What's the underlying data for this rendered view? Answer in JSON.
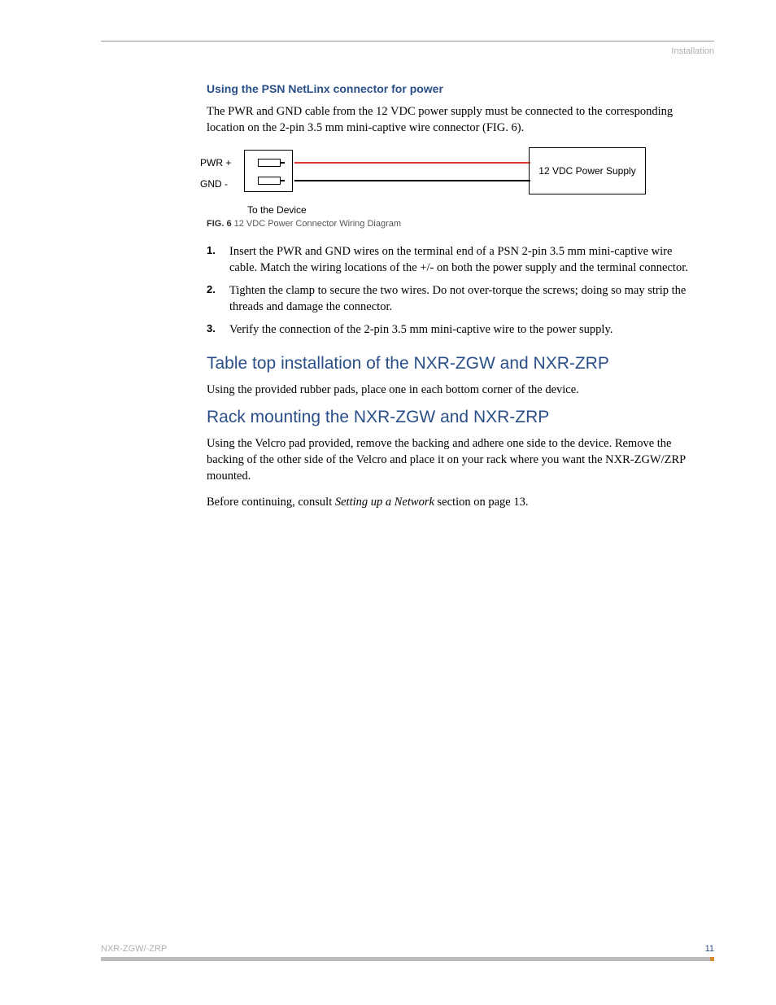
{
  "header": {
    "section": "Installation"
  },
  "sub1": {
    "title": "Using the PSN NetLinx connector for power"
  },
  "para1": "The PWR and GND cable from the 12 VDC power supply must be connected to the corresponding location on the 2-pin 3.5 mm mini-captive wire connector (FIG. 6).",
  "fig": {
    "pwr": "PWR +",
    "gnd": "GND -",
    "psu": "12 VDC Power Supply",
    "todevice": "To the Device",
    "caption_b": "FIG. 6",
    "caption": " 12 VDC Power Connector Wiring Diagram"
  },
  "steps": [
    "Insert the PWR and GND wires on the terminal end of a PSN 2-pin 3.5 mm mini-captive wire cable. Match the wiring locations of the +/- on both the power supply and the terminal connector.",
    "Tighten the clamp to secure the two wires. Do not over-torque the screws; doing so may strip the threads and damage the connector.",
    "Verify the connection of the 2-pin 3.5 mm mini-captive wire to the power supply."
  ],
  "sec2": {
    "title": "Table top installation of the NXR-ZGW and NXR-ZRP",
    "para": "Using the provided rubber pads, place one in each bottom corner of the device."
  },
  "sec3": {
    "title": "Rack mounting the NXR-ZGW and NXR-ZRP",
    "para1": "Using the Velcro pad provided, remove the backing and adhere one side to the device. Remove the backing of the other side of the Velcro and place it on your rack where you want the NXR-ZGW/ZRP mounted.",
    "para2a": "Before continuing, consult ",
    "para2b": "Setting up a Network",
    "para2c": " section on page 13."
  },
  "footer": {
    "doc": "NXR-ZGW/-ZRP",
    "page": "11"
  }
}
